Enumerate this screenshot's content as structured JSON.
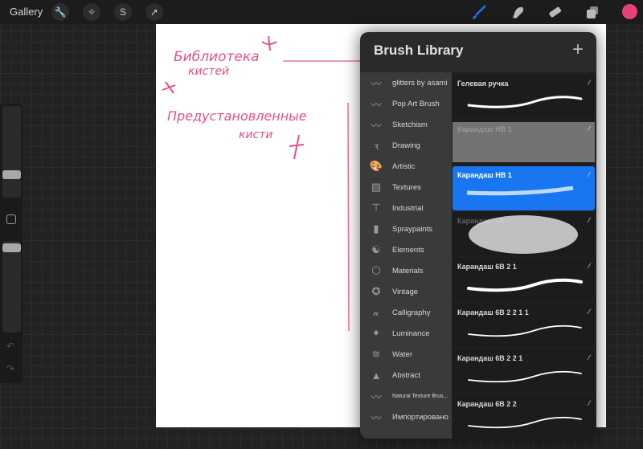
{
  "topbar": {
    "gallery": "Gallery",
    "tools_left": [
      "wrench-icon",
      "magic-wand-icon",
      "selection-icon",
      "transform-arrow-icon"
    ],
    "tools_right": [
      "brush-icon",
      "smudge-icon",
      "eraser-icon",
      "layers-icon"
    ],
    "active_tool": "brush",
    "active_color": "#e5417b",
    "accent": "#1877f0"
  },
  "sidebar": {
    "brush_size": 0.26,
    "opacity": 0.95,
    "undo": "undo-icon",
    "redo": "redo-icon"
  },
  "canvas": {
    "notes": [
      "Библиотека",
      "кистей",
      "Предустановленные",
      "кисти"
    ]
  },
  "panel": {
    "title": "Brush Library",
    "add": "+",
    "categories": [
      {
        "label": "glitters by asami",
        "icon": "stroke-icon"
      },
      {
        "label": "Pop Art Brush",
        "icon": "stroke-icon"
      },
      {
        "label": "Sketchism",
        "icon": "stroke-icon"
      },
      {
        "label": "Drawing",
        "icon": "drawing-icon"
      },
      {
        "label": "Artistic",
        "icon": "palette-icon"
      },
      {
        "label": "Textures",
        "icon": "textures-icon"
      },
      {
        "label": "Industrial",
        "icon": "anvil-icon"
      },
      {
        "label": "Spraypaints",
        "icon": "spray-can-icon"
      },
      {
        "label": "Elements",
        "icon": "yin-yang-icon"
      },
      {
        "label": "Materials",
        "icon": "cube-icon"
      },
      {
        "label": "Vintage",
        "icon": "star-badge-icon"
      },
      {
        "label": "Calligraphy",
        "icon": "calligraphy-icon"
      },
      {
        "label": "Luminance",
        "icon": "sparkle-icon"
      },
      {
        "label": "Water",
        "icon": "waves-icon"
      },
      {
        "label": "Abstract",
        "icon": "triangle-icon"
      },
      {
        "label": "Natural Texture Brus...",
        "icon": "stroke-icon"
      },
      {
        "label": "Импортировано",
        "icon": "stroke-icon"
      }
    ],
    "brushes": [
      {
        "name": "Гелевая ручка",
        "faded": false,
        "selected": false
      },
      {
        "name": "Карандаш НВ 1",
        "faded": true,
        "selected": false
      },
      {
        "name": "Карандаш НВ 1",
        "faded": false,
        "selected": true
      },
      {
        "name": "Карандаш 6В",
        "faded": true,
        "selected": false
      },
      {
        "name": "Карандаш 6В 2 1",
        "faded": false,
        "selected": false
      },
      {
        "name": "Карандаш 6В 2 2 1 1",
        "faded": false,
        "selected": false
      },
      {
        "name": "Карандаш 6В 2 2 1",
        "faded": false,
        "selected": false
      },
      {
        "name": "Карандаш 6В 2 2",
        "faded": false,
        "selected": false
      }
    ]
  }
}
